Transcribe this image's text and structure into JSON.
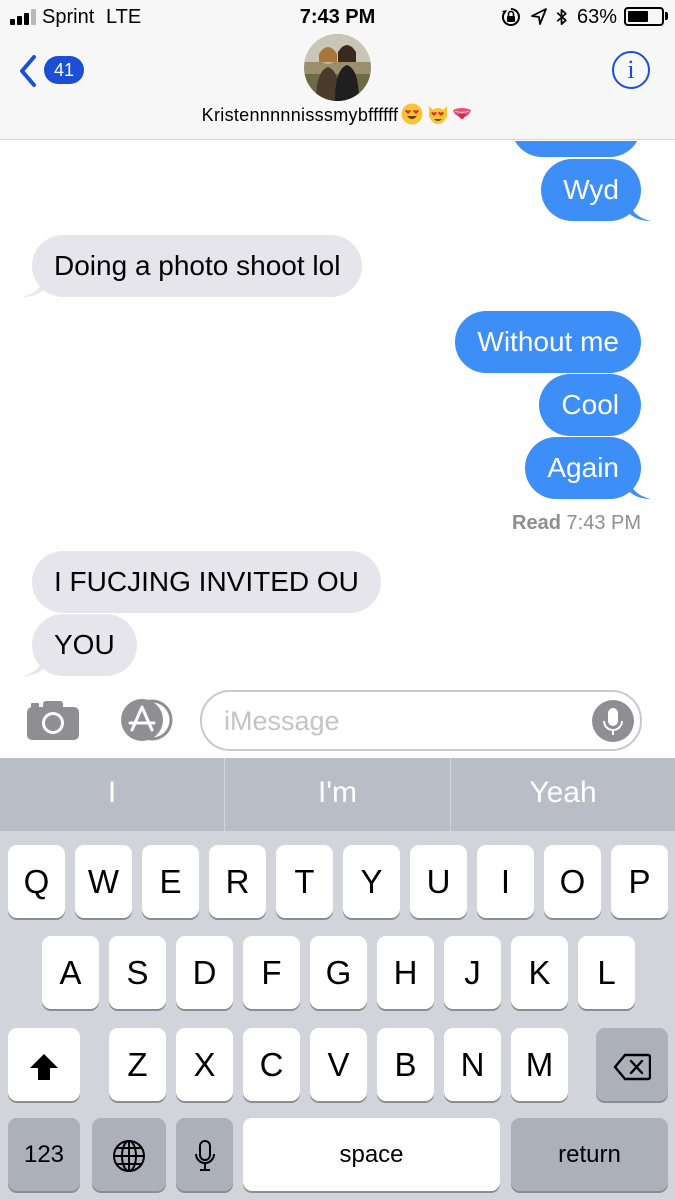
{
  "status_bar": {
    "carrier": "Sprint",
    "network": "LTE",
    "time": "7:43 PM",
    "battery": "63%",
    "battery_level": 0.63,
    "icons": [
      "orientation-lock-icon",
      "location-icon",
      "bluetooth-icon"
    ]
  },
  "header": {
    "back_badge": "41",
    "contact_name": "Kristennnnnisssmybffffff",
    "emojis": [
      "heart-eyes-emoji",
      "heart-eyes-cat-emoji",
      "tongue-emoji"
    ],
    "info_label": "i"
  },
  "messages": [
    {
      "from": "me",
      "text": "Wyd"
    },
    {
      "from": "them",
      "text": "Doing a photo shoot lol"
    },
    {
      "from": "me",
      "text": "Without me"
    },
    {
      "from": "me",
      "text": "Cool"
    },
    {
      "from": "me",
      "text": "Again"
    },
    {
      "from": "them",
      "text": "I FUCJING INVITED OU"
    },
    {
      "from": "them",
      "text": "YOU"
    }
  ],
  "read_receipt": {
    "label": "Read",
    "time": "7:43 PM"
  },
  "composer": {
    "placeholder": "iMessage"
  },
  "keyboard": {
    "predictions": [
      "I",
      "I'm",
      "Yeah"
    ],
    "row1": [
      "Q",
      "W",
      "E",
      "R",
      "T",
      "Y",
      "U",
      "I",
      "O",
      "P"
    ],
    "row2": [
      "A",
      "S",
      "D",
      "F",
      "G",
      "H",
      "J",
      "K",
      "L"
    ],
    "row3": [
      "Z",
      "X",
      "C",
      "V",
      "B",
      "N",
      "M"
    ],
    "numbers_key": "123",
    "space_key": "space",
    "return_key": "return"
  },
  "colors": {
    "sent_bubble": "#3d8ef7",
    "received_bubble": "#e6e5eb",
    "accent": "#1a4fd6",
    "keyboard_bg": "#d1d4da"
  }
}
